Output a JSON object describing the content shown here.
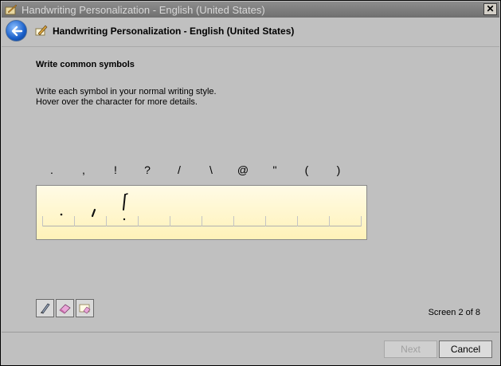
{
  "window": {
    "title": "Handwriting Personalization - English (United States)",
    "close_label": "✕"
  },
  "header": {
    "title": "Handwriting Personalization - English (United States)"
  },
  "content": {
    "section_title": "Write common symbols",
    "instructions": [
      "Write each symbol in your normal writing style.",
      "Hover over the character for more details."
    ],
    "symbols": [
      ".",
      ",",
      "!",
      "?",
      "/",
      "\\",
      "@",
      "\"",
      "(",
      ")"
    ],
    "screen_counter": "Screen 2 of 8"
  },
  "tools": [
    {
      "name": "pen-tool-icon"
    },
    {
      "name": "eraser-icon"
    },
    {
      "name": "clear-all-icon"
    }
  ],
  "footer": {
    "next_label": "Next",
    "next_enabled": false,
    "cancel_label": "Cancel"
  },
  "colors": {
    "pad_top": "#fffbe6",
    "pad_bottom": "#fff2b8",
    "titlebar": "#7d7d7d"
  }
}
